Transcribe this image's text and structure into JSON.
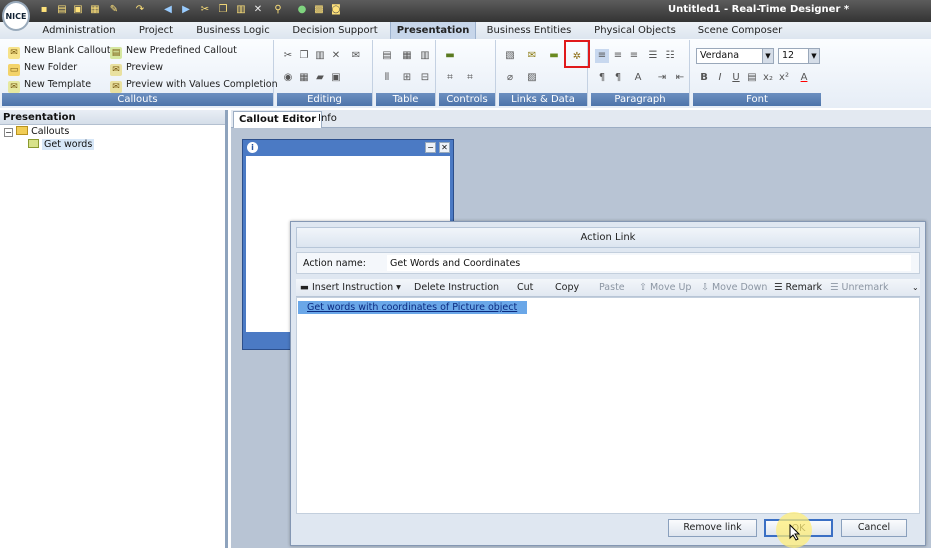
{
  "app": {
    "title": "Untitled1 - Real-Time Designer *",
    "logo": "NICE"
  },
  "quick_access_icons": [
    "new-icon",
    "open-icon",
    "save-icon",
    "save-all-icon",
    "edit-icon",
    "redo-icon",
    "back-icon",
    "forward-icon",
    "cut-icon",
    "copy-icon",
    "close-icon",
    "find-icon",
    "run-icon",
    "capture-icon",
    "camera-icon"
  ],
  "menu": [
    "Administration",
    "Project",
    "Business Logic",
    "Decision Support",
    "Presentation",
    "Business Entities",
    "Physical Objects",
    "Scene Composer"
  ],
  "menu_active": "Presentation",
  "ribbon": {
    "callouts": {
      "name": "Callouts",
      "items": [
        "New Blank Callout",
        "New Folder",
        "New Template",
        "New Predefined Callout",
        "Preview",
        "Preview with Values Completion"
      ]
    },
    "editing": "Editing",
    "table": "Table",
    "controls": "Controls",
    "links_data": "Links & Data",
    "paragraph": "Paragraph",
    "font": {
      "name": "Font",
      "family": "Verdana",
      "size": "12"
    }
  },
  "left_panel": {
    "title": "Presentation",
    "tree": [
      {
        "label": "Callouts"
      },
      {
        "label": "Get words"
      }
    ]
  },
  "editor_tabs": [
    "Callout Editor",
    "Info"
  ],
  "dialog": {
    "title": "Action Link",
    "name_label": "Action name:",
    "name_value": "Get Words and Coordinates",
    "toolbar": [
      "Insert Instruction",
      "Delete Instruction",
      "Cut",
      "Copy",
      "Paste",
      "Move Up",
      "Move Down",
      "Remark",
      "Unremark"
    ],
    "items": [
      "Get words with coordinates of Picture object"
    ],
    "buttons": {
      "remove": "Remove link",
      "ok": "OK",
      "cancel": "Cancel"
    }
  }
}
